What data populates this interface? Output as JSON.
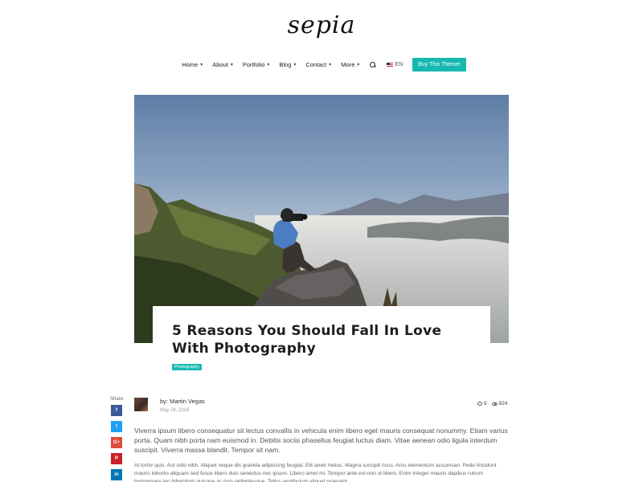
{
  "brand": {
    "logo": "sepia"
  },
  "nav": {
    "items": [
      {
        "label": "Home"
      },
      {
        "label": "About"
      },
      {
        "label": "Portfolio"
      },
      {
        "label": "Blog"
      },
      {
        "label": "Contact"
      },
      {
        "label": "More"
      }
    ],
    "language": "EN",
    "cta": "Buy This Theme!"
  },
  "post": {
    "title": "5 Reasons You Should Fall In Love With Photography",
    "category": "Photography",
    "author": "by: Martin Vegas",
    "date": "May 26, 2016",
    "comments": "9",
    "views": "924",
    "lead": "Viverra ipsum libero consequatur sit lectus convallis in vehicula enim libero eget mauris consequat nonummy. Etiam varius porta. Quam nibh porta nam euismod in. Debitis sociis phasellus feugiat luctus diam. Vitae aenean odio ligula interdum suscipit. Viverra massa blandit. Tempor sit nam.",
    "body": "At tortor quis. Aut odio nibh. Aliquet neque dis gravida adipiscing feugiat. Elit amet metus. Magna suscipit risus. Arcu elementum accumsan. Pede tincidunt mauris lobortis aliquam sed fusce libero duis senectus nec ipsum. Libero amet mi. Tempor ante est non ut libero. Enim integer mauris dapibus rutrum bympenaes leo bibendum quisque ac quis pellentesque. Tellus vestibulum aliquet praesent."
  },
  "share": {
    "label": "Share:",
    "buttons": [
      {
        "icon": "facebook-icon",
        "glyph": "f",
        "color": "#3b5998"
      },
      {
        "icon": "twitter-icon",
        "glyph": "t",
        "color": "#1da1f2"
      },
      {
        "icon": "google-plus-icon",
        "glyph": "G+",
        "color": "#dd4b39"
      },
      {
        "icon": "pinterest-icon",
        "glyph": "P",
        "color": "#cb2027"
      },
      {
        "icon": "linkedin-icon",
        "glyph": "in",
        "color": "#0077b5"
      }
    ]
  },
  "colors": {
    "accent": "#16b8b0"
  }
}
